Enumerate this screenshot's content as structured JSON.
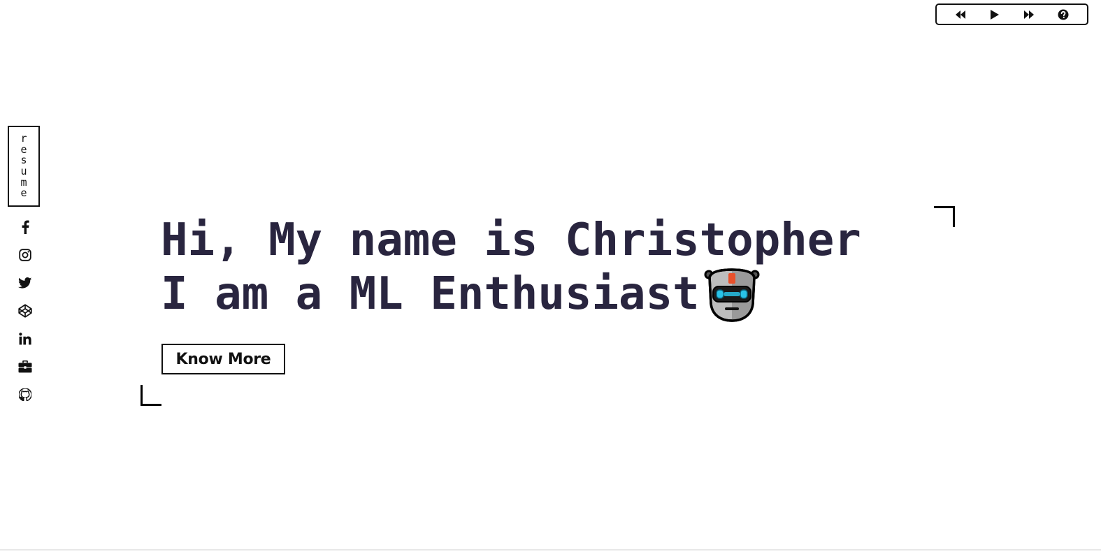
{
  "player": {
    "controls": [
      {
        "name": "rewind-icon"
      },
      {
        "name": "play-icon"
      },
      {
        "name": "fast-forward-icon"
      },
      {
        "name": "help-icon"
      }
    ]
  },
  "sidebar": {
    "resume_letters": [
      "r",
      "e",
      "s",
      "u",
      "m",
      "e"
    ],
    "socials": [
      "facebook-icon",
      "instagram-icon",
      "twitter-icon",
      "codepen-icon",
      "linkedin-icon",
      "briefcase-icon",
      "github-icon"
    ]
  },
  "hero": {
    "line1": "Hi, My name is Christopher",
    "line2": "I am a ML Enthusiast",
    "emoji": "robot-icon",
    "cta_label": "Know More"
  },
  "colors": {
    "heading": "#29253f",
    "border": "#111111",
    "background": "#ffffff",
    "robot_eyes": "#29c3e8",
    "robot_antenna": "#e8502b"
  }
}
